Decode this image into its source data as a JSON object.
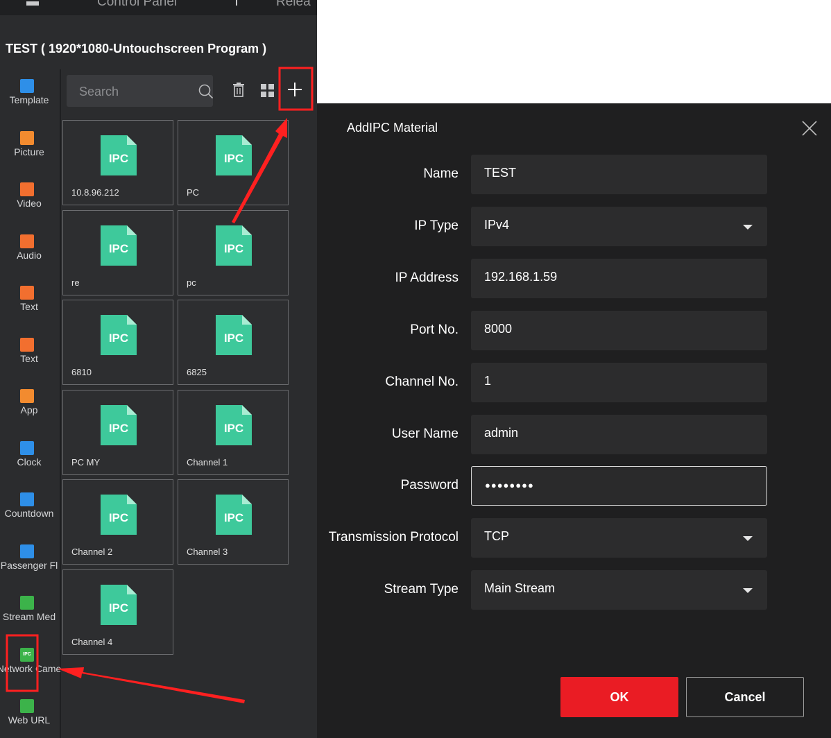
{
  "tabs": [
    {
      "label": "Control Panel",
      "icon": "panel-icon"
    },
    {
      "label": "Relea",
      "icon": "release-icon"
    }
  ],
  "program_title": "TEST ( 1920*1080-Untouchscreen Program )",
  "types": [
    {
      "label": "Template",
      "icon": "template-icon",
      "color": "#2e8fe8"
    },
    {
      "label": "Picture",
      "icon": "picture-icon",
      "color": "#f28b2f"
    },
    {
      "label": "Video",
      "icon": "video-icon",
      "color": "#f26f2f"
    },
    {
      "label": "Audio",
      "icon": "audio-icon",
      "color": "#f26f2f"
    },
    {
      "label": "Text",
      "icon": "text-icon",
      "color": "#f26f2f"
    },
    {
      "label": "Text",
      "icon": "document-text-icon",
      "color": "#f26f2f"
    },
    {
      "label": "App",
      "icon": "android-app-icon",
      "color": "#f28b2f"
    },
    {
      "label": "Clock",
      "icon": "clock-icon",
      "color": "#2e8fe8"
    },
    {
      "label": "Countdown",
      "icon": "hourglass-icon",
      "color": "#2e8fe8"
    },
    {
      "label": "Passenger Fl",
      "icon": "passenger-flow-icon",
      "color": "#2e8fe8"
    },
    {
      "label": "Stream Med",
      "icon": "stream-media-icon",
      "color": "#3cb34a"
    },
    {
      "label": "Network Came",
      "icon": "ipc-icon",
      "color": "#3cb34a"
    },
    {
      "label": "Web URL",
      "icon": "web-url-icon",
      "color": "#3cb34a"
    }
  ],
  "search": {
    "placeholder": "Search"
  },
  "materials": [
    {
      "badge": "IPC",
      "name": "10.8.96.212"
    },
    {
      "badge": "IPC",
      "name": "PC"
    },
    {
      "badge": "IPC",
      "name": "re"
    },
    {
      "badge": "IPC",
      "name": "pc"
    },
    {
      "badge": "IPC",
      "name": "6810"
    },
    {
      "badge": "IPC",
      "name": "6825"
    },
    {
      "badge": "IPC",
      "name": "PC MY"
    },
    {
      "badge": "IPC",
      "name": "Channel 1"
    },
    {
      "badge": "IPC",
      "name": "Channel 2"
    },
    {
      "badge": "IPC",
      "name": "Channel 3"
    },
    {
      "badge": "IPC",
      "name": "Channel 4"
    }
  ],
  "dialog": {
    "title": "AddIPC Material",
    "fields": [
      {
        "label": "Name",
        "value": "TEST",
        "dropdown": false
      },
      {
        "label": "IP Type",
        "value": "IPv4",
        "dropdown": true
      },
      {
        "label": "IP Address",
        "value": "192.168.1.59",
        "dropdown": false
      },
      {
        "label": "Port No.",
        "value": "8000",
        "dropdown": false
      },
      {
        "label": "Channel No.",
        "value": "1",
        "dropdown": false
      },
      {
        "label": "User Name",
        "value": "admin",
        "dropdown": false
      },
      {
        "label": "Password",
        "value": "●●●●●●●●",
        "dropdown": false
      },
      {
        "label": "Transmission Protocol",
        "value": "TCP",
        "dropdown": true
      },
      {
        "label": "Stream Type",
        "value": "Main Stream",
        "dropdown": true
      }
    ],
    "ok_label": "OK",
    "cancel_label": "Cancel"
  },
  "colors": {
    "accent_red": "#ea1c24",
    "ipc_green": "#3ec99b",
    "highlight_red": "#ff2020"
  }
}
